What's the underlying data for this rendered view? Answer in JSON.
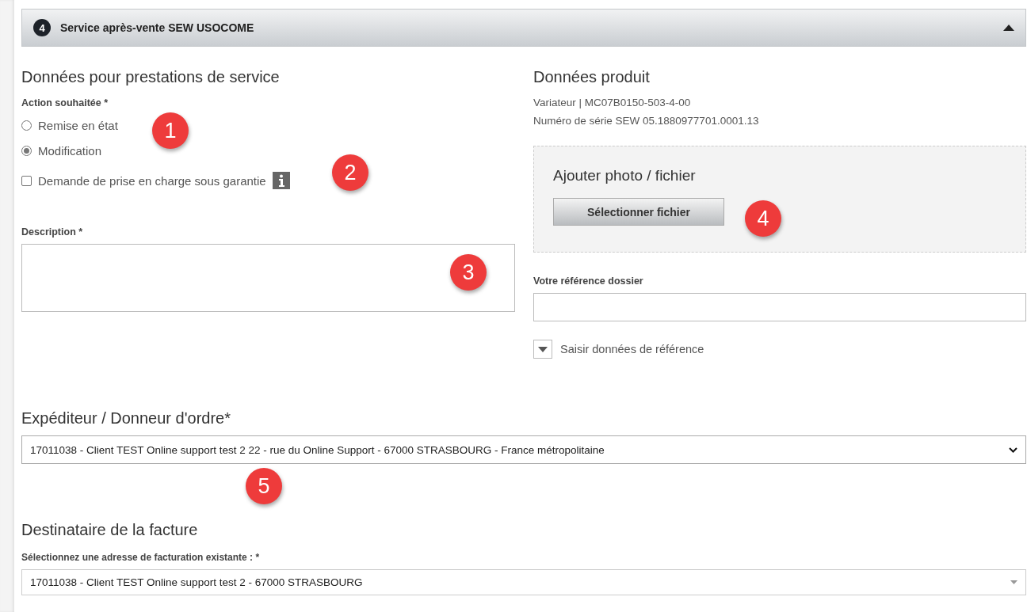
{
  "section": {
    "number": "4",
    "title": "Service après-vente SEW USOCOME",
    "expanded": true
  },
  "service": {
    "title": "Données pour prestations de service",
    "action_label": "Action souhaitée *",
    "options": [
      {
        "label": "Remise en état",
        "selected": false
      },
      {
        "label": "Modification",
        "selected": true
      }
    ],
    "callout_action": "1",
    "warranty": {
      "label": "Demande de prise en charge sous garantie",
      "checked": false,
      "callout": "2"
    },
    "description": {
      "label": "Description *",
      "callout": "3"
    }
  },
  "product": {
    "title": "Données produit",
    "lines": [
      "Variateur | MC07B0150-503-4-00",
      "Numéro de série SEW 05.1880977701.0001.13"
    ],
    "upload": {
      "title": "Ajouter photo / fichier",
      "button": "Sélectionner fichier",
      "callout": "4"
    },
    "reference": {
      "label": "Votre référence dossier"
    },
    "toggle": {
      "label": "Saisir données de référence",
      "expanded": false
    }
  },
  "sender": {
    "title": "Expéditeur / Donneur d'ordre*",
    "value": "17011038 - Client TEST Online support test 2 22 - rue du Online Support - 67000 STRASBOURG - France métropolitaine",
    "callout": "5"
  },
  "billing": {
    "title": "Destinataire de la facture",
    "label": "Sélectionnez une adresse de facturation existante : *",
    "value": "17011038 - Client TEST Online support test 2 - 67000 STRASBOURG"
  }
}
